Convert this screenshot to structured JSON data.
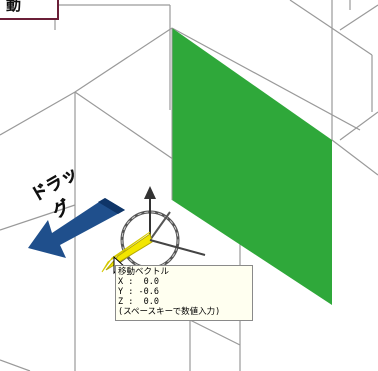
{
  "corner_label": "動",
  "drag_label_line1": "ドラッ",
  "drag_label_line2": "グ",
  "tooltip": {
    "title": "移動ベクトル",
    "x_line": "X :  0.0",
    "y_line": "Y : -0.6",
    "z_line": "Z :  0.0",
    "hint": "(スペースキーで数値入力)"
  },
  "colors": {
    "green_plane": "#2fa83a",
    "arrow_blue": "#1f4f8c",
    "gizmo_yellow": "#f2e600",
    "wire": "#9a9a9a",
    "label_border": "#6b1f38"
  }
}
